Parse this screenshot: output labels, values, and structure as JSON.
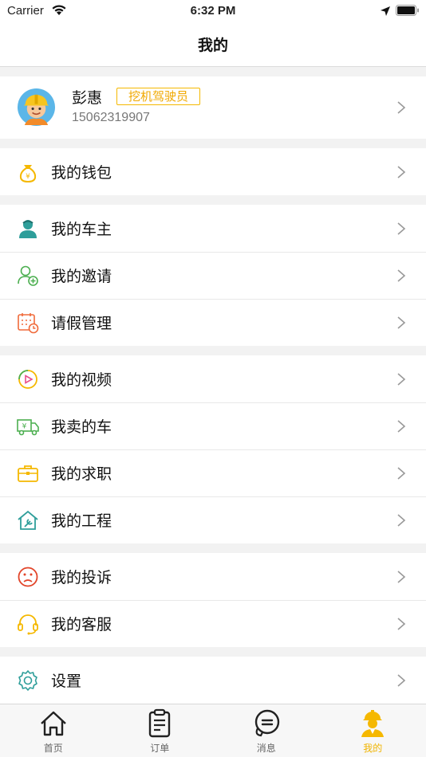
{
  "status_bar": {
    "carrier": "Carrier",
    "time": "6:32 PM"
  },
  "nav": {
    "title": "我的"
  },
  "profile": {
    "name": "彭惠",
    "role": "挖机驾驶员",
    "phone": "15062319907"
  },
  "groups": [
    [
      {
        "label": "我的钱包",
        "icon": "wallet-icon"
      }
    ],
    [
      {
        "label": "我的车主",
        "icon": "car-owner-icon"
      },
      {
        "label": "我的邀请",
        "icon": "invite-icon"
      },
      {
        "label": "请假管理",
        "icon": "calendar-leave-icon"
      }
    ],
    [
      {
        "label": "我的视频",
        "icon": "video-icon"
      },
      {
        "label": "我卖的车",
        "icon": "truck-sale-icon"
      },
      {
        "label": "我的求职",
        "icon": "briefcase-icon"
      },
      {
        "label": "我的工程",
        "icon": "house-tool-icon"
      }
    ],
    [
      {
        "label": "我的投诉",
        "icon": "complaint-face-icon"
      },
      {
        "label": "我的客服",
        "icon": "headset-icon"
      }
    ],
    [
      {
        "label": "设置",
        "icon": "gear-icon"
      }
    ]
  ],
  "tabs": [
    {
      "label": "首页",
      "icon": "home-icon"
    },
    {
      "label": "订单",
      "icon": "clipboard-icon"
    },
    {
      "label": "消息",
      "icon": "message-icon"
    },
    {
      "label": "我的",
      "icon": "worker-icon",
      "active": true
    }
  ],
  "colors": {
    "accent": "#f5b800",
    "background": "#f2f2f2"
  }
}
